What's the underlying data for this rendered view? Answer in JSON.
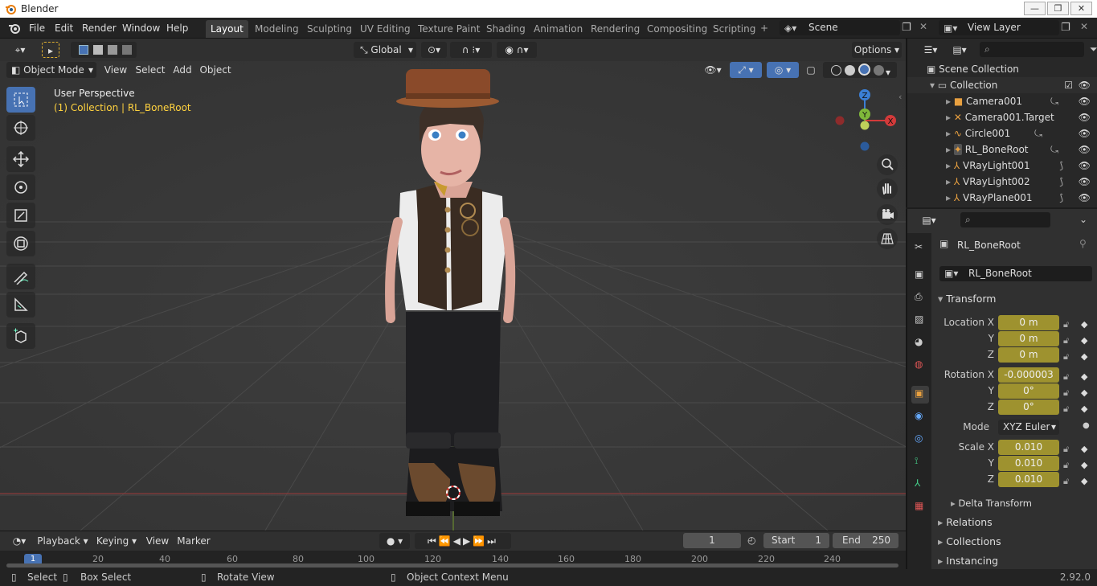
{
  "window": {
    "title": "Blender",
    "controls": [
      "—",
      "❐",
      "✕"
    ]
  },
  "menu": [
    "File",
    "Edit",
    "Render",
    "Window",
    "Help"
  ],
  "workspaces": [
    "Layout",
    "Modeling",
    "Sculpting",
    "UV Editing",
    "Texture Paint",
    "Shading",
    "Animation",
    "Rendering",
    "Compositing",
    "Scripting"
  ],
  "active_workspace": "Layout",
  "scene": {
    "name": "Scene"
  },
  "view_layer": {
    "name": "View Layer"
  },
  "toolbar": {
    "transform_orientation": "Global",
    "options_label": "Options"
  },
  "viewport_header": {
    "mode": "Object Mode",
    "menus": [
      "View",
      "Select",
      "Add",
      "Object"
    ]
  },
  "viewport": {
    "perspective": "User Perspective",
    "context": "(1) Collection | RL_BoneRoot"
  },
  "gizmo": {
    "z": "Z",
    "y": "Y",
    "x": "X"
  },
  "outliner": {
    "search_placeholder": "",
    "root": "Scene Collection",
    "collection": "Collection",
    "items": [
      {
        "label": "Camera001"
      },
      {
        "label": "Camera001.Target"
      },
      {
        "label": "Circle001"
      },
      {
        "label": "RL_BoneRoot"
      },
      {
        "label": "VRayLight001"
      },
      {
        "label": "VRayLight002"
      },
      {
        "label": "VRayPlane001"
      }
    ]
  },
  "properties": {
    "object_name": "RL_BoneRoot",
    "name_field": "RL_BoneRoot",
    "transform_title": "Transform",
    "location": {
      "label": "Location X",
      "x": "0 m",
      "y": "0 m",
      "z": "0 m"
    },
    "rotation": {
      "label": "Rotation X",
      "x": "-0.000003",
      "y": "0°",
      "z": "0°"
    },
    "mode": {
      "label": "Mode",
      "value": "XYZ Euler"
    },
    "scale": {
      "label": "Scale X",
      "x": "0.010",
      "y": "0.010",
      "z": "0.010"
    },
    "axis_y": "Y",
    "axis_z": "Z",
    "delta_transform": "Delta Transform",
    "relations": "Relations",
    "collections": "Collections",
    "instancing": "Instancing"
  },
  "timeline": {
    "menus": [
      "Playback",
      "Keying",
      "View",
      "Marker"
    ],
    "current_frame": "1",
    "start_label": "Start",
    "start": "1",
    "end_label": "End",
    "end": "250",
    "ruler": [
      "1",
      "20",
      "40",
      "60",
      "80",
      "100",
      "120",
      "140",
      "160",
      "180",
      "200",
      "220",
      "240"
    ]
  },
  "status": {
    "select": "Select",
    "box_select": "Box Select",
    "rotate_view": "Rotate View",
    "context_menu": "Object Context Menu",
    "version": "2.92.0"
  },
  "colors": {
    "accent": "#4772b3",
    "field_yellow": "#9e922f",
    "context_yellow": "#ffd23f"
  }
}
